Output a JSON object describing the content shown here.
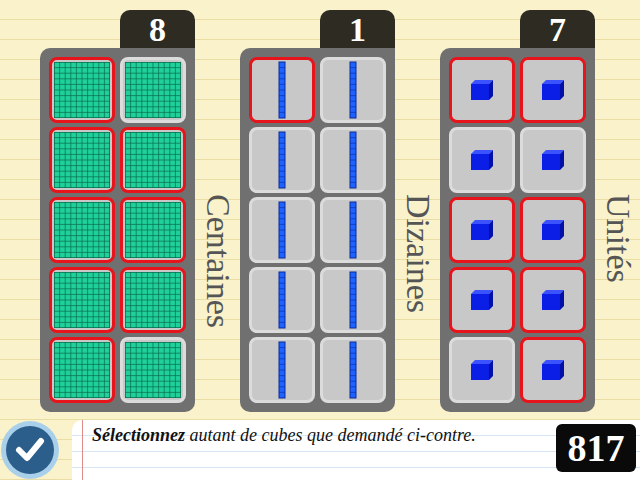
{
  "columns": [
    {
      "number": "8",
      "label": "Centaines",
      "kind": "hundred",
      "tiles": [
        {
          "selected": true
        },
        {
          "selected": false
        },
        {
          "selected": true
        },
        {
          "selected": true
        },
        {
          "selected": true
        },
        {
          "selected": true
        },
        {
          "selected": true
        },
        {
          "selected": true
        },
        {
          "selected": true
        },
        {
          "selected": false
        }
      ]
    },
    {
      "number": "1",
      "label": "Dizaines",
      "kind": "ten",
      "tiles": [
        {
          "selected": true
        },
        {
          "selected": false
        },
        {
          "selected": false
        },
        {
          "selected": false
        },
        {
          "selected": false
        },
        {
          "selected": false
        },
        {
          "selected": false
        },
        {
          "selected": false
        },
        {
          "selected": false
        },
        {
          "selected": false
        }
      ]
    },
    {
      "number": "7",
      "label": "Unités",
      "kind": "unit",
      "tiles": [
        {
          "selected": true
        },
        {
          "selected": true
        },
        {
          "selected": false
        },
        {
          "selected": false
        },
        {
          "selected": true
        },
        {
          "selected": true
        },
        {
          "selected": true
        },
        {
          "selected": true
        },
        {
          "selected": false
        },
        {
          "selected": true
        }
      ]
    }
  ],
  "instruction": {
    "emphasis": "Sélectionnez",
    "rest": " autant de cubes que demandé ci-contre."
  },
  "target": "817"
}
